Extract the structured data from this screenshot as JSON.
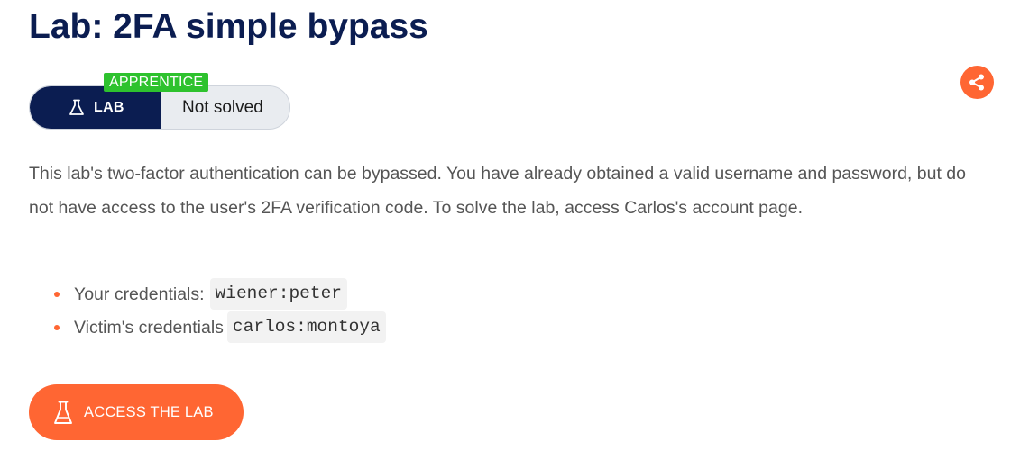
{
  "header": {
    "title": "Lab: 2FA simple bypass"
  },
  "status": {
    "level": "APPRENTICE",
    "type_label": "LAB",
    "state": "Not solved"
  },
  "description": "This lab's two-factor authentication can be bypassed. You have already obtained a valid username and password, but do not have access to the user's 2FA verification code. To solve the lab, access Carlos's account page.",
  "credentials": [
    {
      "label": "Your credentials:",
      "value": "wiener:peter"
    },
    {
      "label": "Victim's credentials",
      "value": "carlos:montoya"
    }
  ],
  "actions": {
    "access_label": "ACCESS THE LAB"
  },
  "icons": {
    "share": "share-icon",
    "flask": "flask-icon"
  },
  "colors": {
    "title": "#0b1d51",
    "accent": "#ff6633",
    "badge": "#2ec22e",
    "lab_segment": "#0b1d51"
  }
}
